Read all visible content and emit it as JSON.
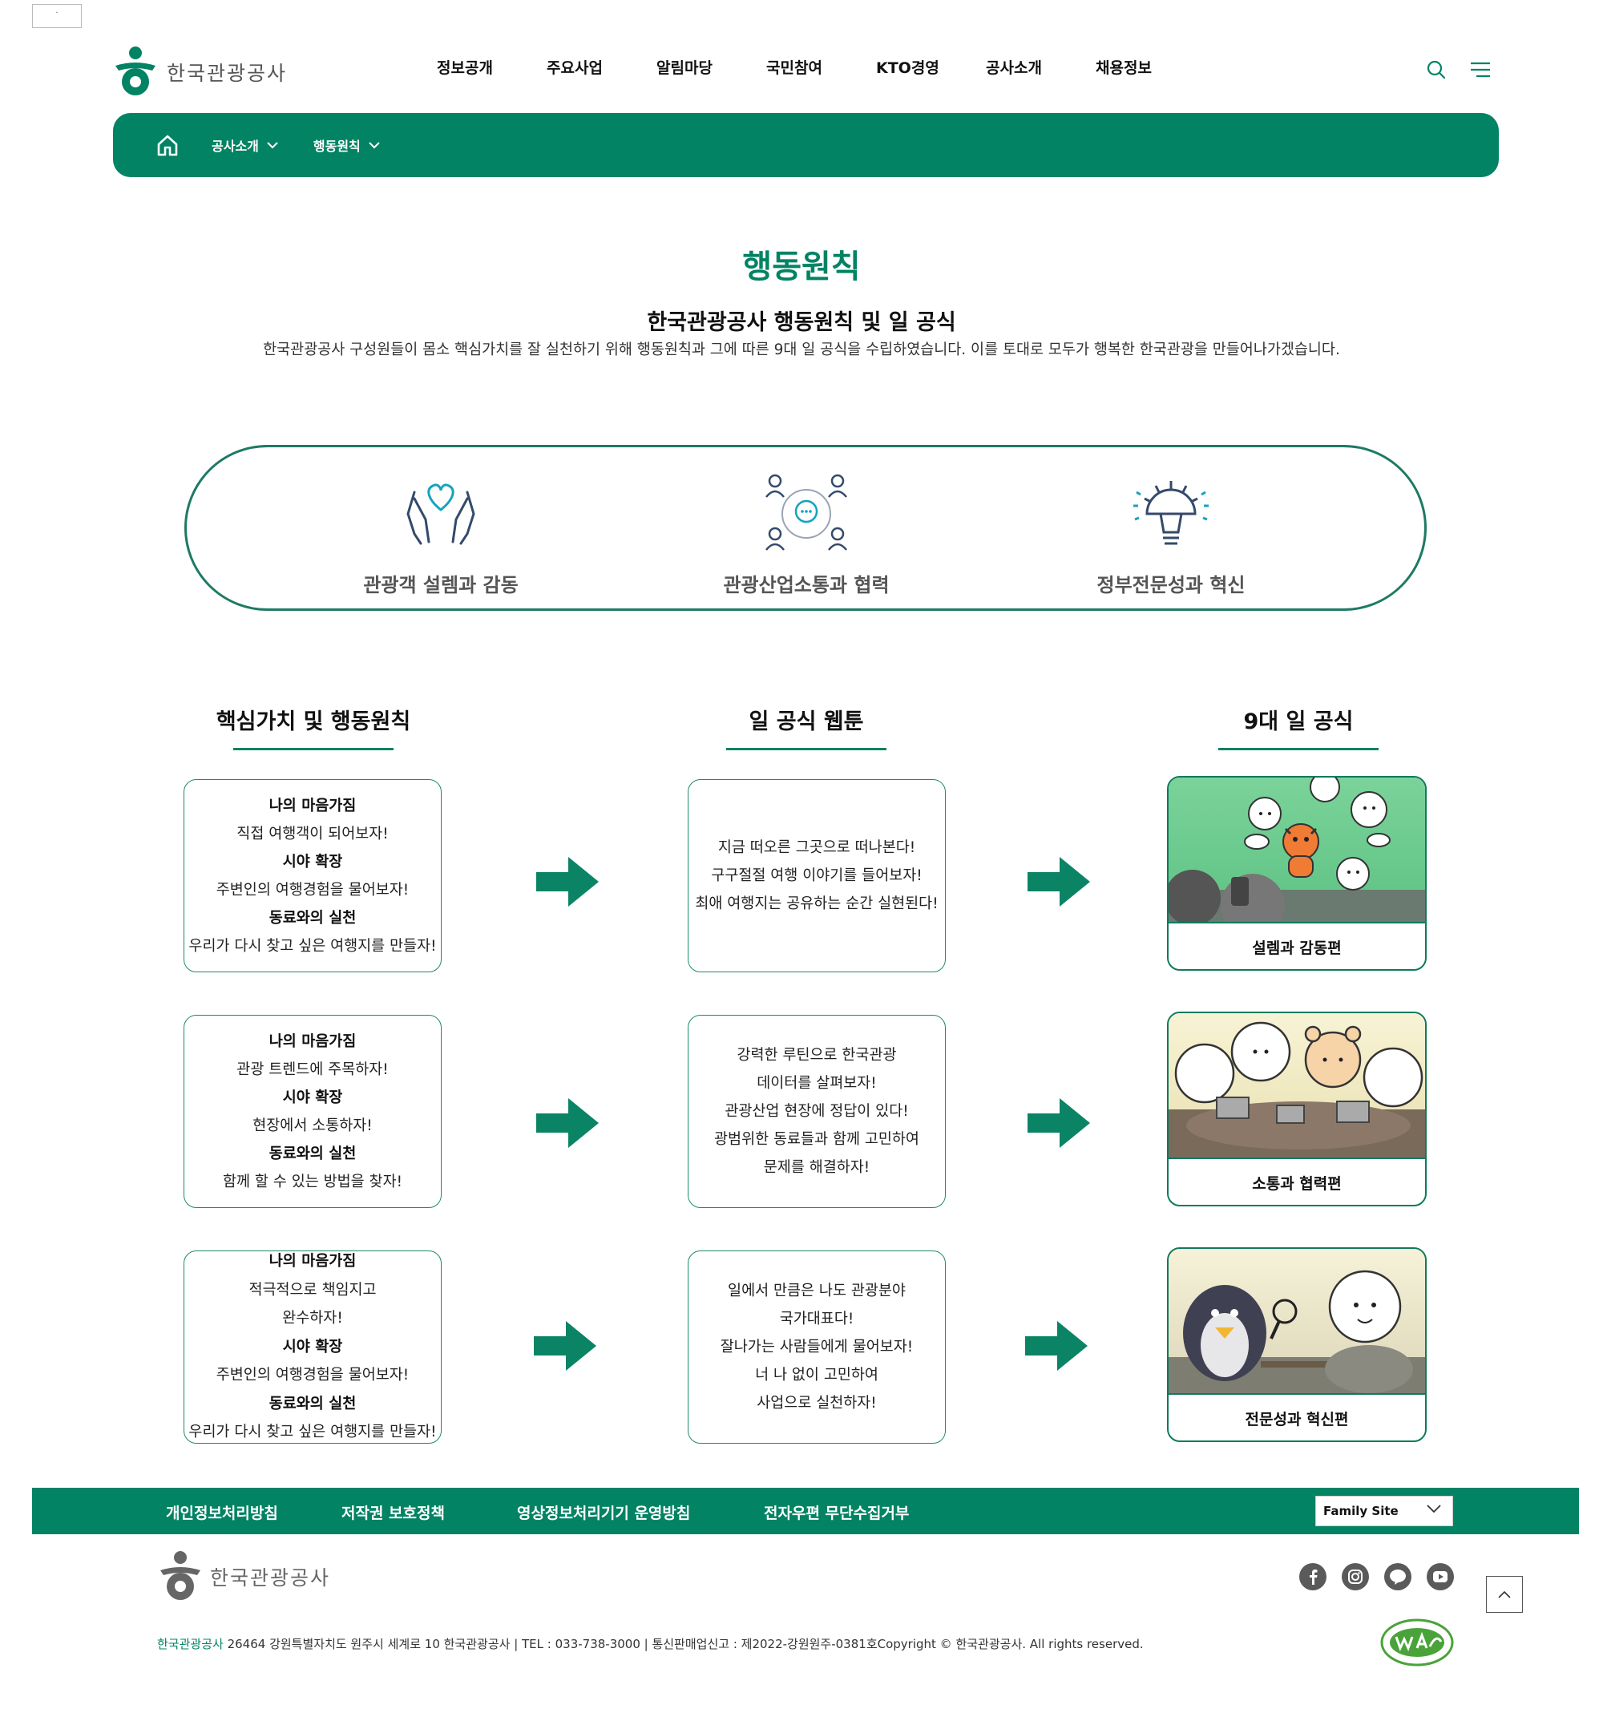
{
  "skip_link": "·",
  "header": {
    "logo_text": "한국관광공사",
    "nav": [
      "정보공개",
      "주요사업",
      "알림마당",
      "국민참여",
      "KTO경영",
      "공사소개",
      "채용정보"
    ]
  },
  "breadcrumb": {
    "items": [
      "공사소개",
      "행동원칙"
    ]
  },
  "main": {
    "page_title": "행동원칙",
    "sub_title": "한국관광공사 행동원칙 및 일 공식",
    "intro": "한국관광공사 구성원들이 몸소 핵심가치를 잘 실천하기 위해 행동원칙과 그에 따른 9대 일 공식을 수립하였습니다. 이를 토대로 모두가 행복한 한국관광을 만들어나가겠습니다.",
    "values": [
      "관광객 설렘과 감동",
      "관광산업소통과 협력",
      "정부전문성과 혁신"
    ],
    "columns": [
      "핵심가치 및 행동원칙",
      "일 공식 웹툰",
      "9대 일 공식"
    ],
    "rows": [
      {
        "principles": [
          "나의 마음가짐",
          "직접 여행객이 되어보자!",
          "시야 확장",
          "주변인의 여행경험을 물어보자!",
          "동료와의 실천",
          "우리가 다시 찾고 싶은 여행지를 만들자!"
        ],
        "webtoon": [
          "지금 떠오른 그곳으로 떠나본다!",
          "구구절절 여행 이야기를 들어보자!",
          "최애 여행지는 공유하는 순간 실현된다!"
        ],
        "card": "설렘과 감동편"
      },
      {
        "principles": [
          "나의 마음가짐",
          "관광 트렌드에 주목하자!",
          "시야 확장",
          "현장에서 소통하자!",
          "동료와의 실천",
          "함께 할 수 있는 방법을 찾자!"
        ],
        "webtoon": [
          "강력한 루틴으로 한국관광",
          "데이터를 살펴보자!",
          "관광산업 현장에 정답이 있다!",
          "광범위한 동료들과 함께 고민하여",
          "문제를 해결하자!"
        ],
        "card": "소통과 협력편"
      },
      {
        "principles": [
          "나의 마음가짐",
          "적극적으로 책임지고",
          "완수하자!",
          "시야 확장",
          "주변인의 여행경험을 물어보자!",
          "동료와의 실천",
          "우리가 다시 찾고 싶은 여행지를 만들자!"
        ],
        "webtoon": [
          "일에서 만큼은 나도 관광분야",
          "국가대표다!",
          "잘나가는 사람들에게 물어보자!",
          "너 나 없이 고민하여",
          "사업으로 실천하자!"
        ],
        "card": "전문성과 혁신편"
      }
    ]
  },
  "footer": {
    "links": [
      "개인정보처리방침",
      "저작권 보호정책",
      "영상정보처리기기 운영방침",
      "전자우편 무단수집거부"
    ],
    "family_site": "Family Site",
    "logo_text": "한국관광공사",
    "address_org": "한국관광공사",
    "address": " 26464 강원특별자치도 원주시 세계로 10 한국관광공사 | TEL : 033-738-3000 | 통신판매업신고 : 제2022-강원원주-0381호Copyright © 한국관광공사. All rights reserved.",
    "sns": [
      "facebook-icon",
      "instagram-icon",
      "blog-icon",
      "youtube-icon"
    ]
  },
  "colors": {
    "brand": "#028363",
    "text": "#222222"
  }
}
